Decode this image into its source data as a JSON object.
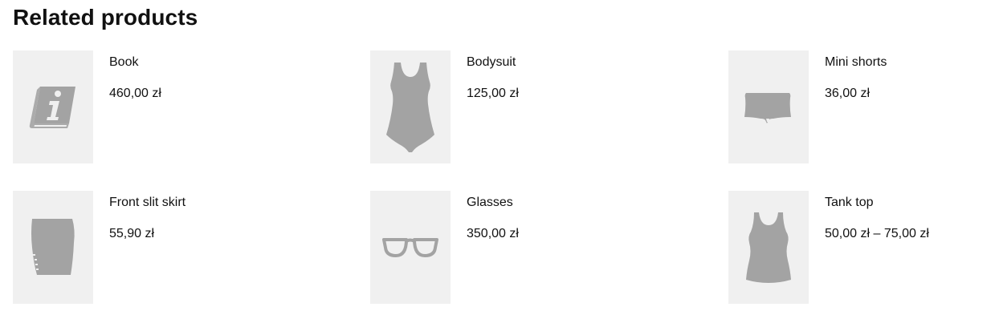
{
  "section": {
    "title": "Related products"
  },
  "products": [
    {
      "name": "Book",
      "price": "460,00 zł",
      "icon": "book-icon"
    },
    {
      "name": "Bodysuit",
      "price": "125,00 zł",
      "icon": "bodysuit-icon"
    },
    {
      "name": "Mini shorts",
      "price": "36,00 zł",
      "icon": "shorts-icon"
    },
    {
      "name": "Front slit skirt",
      "price": "55,90 zł",
      "icon": "skirt-icon"
    },
    {
      "name": "Glasses",
      "price": "350,00 zł",
      "icon": "glasses-icon"
    },
    {
      "name": "Tank top",
      "price": "50,00 zł – 75,00 zł",
      "icon": "tank-top-icon"
    }
  ],
  "colors": {
    "thumb_background": "#f0f0f0",
    "icon_fill": "#a3a3a3",
    "text": "#111111"
  }
}
